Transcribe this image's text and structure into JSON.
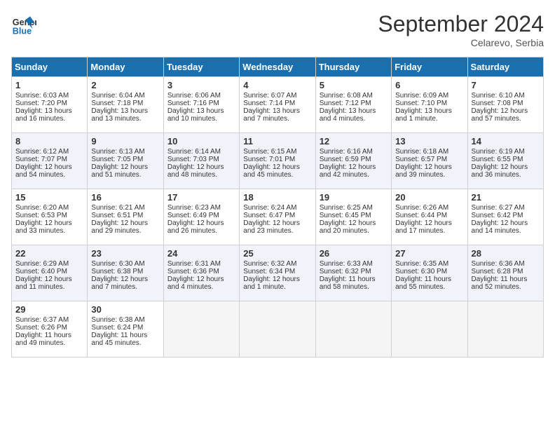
{
  "header": {
    "logo_line1": "General",
    "logo_line2": "Blue",
    "month": "September 2024",
    "location": "Celarevo, Serbia"
  },
  "days_of_week": [
    "Sunday",
    "Monday",
    "Tuesday",
    "Wednesday",
    "Thursday",
    "Friday",
    "Saturday"
  ],
  "weeks": [
    [
      {
        "day": 1,
        "sunrise": "6:03 AM",
        "sunset": "7:20 PM",
        "daylight": "13 hours and 16 minutes."
      },
      {
        "day": 2,
        "sunrise": "6:04 AM",
        "sunset": "7:18 PM",
        "daylight": "13 hours and 13 minutes."
      },
      {
        "day": 3,
        "sunrise": "6:06 AM",
        "sunset": "7:16 PM",
        "daylight": "13 hours and 10 minutes."
      },
      {
        "day": 4,
        "sunrise": "6:07 AM",
        "sunset": "7:14 PM",
        "daylight": "13 hours and 7 minutes."
      },
      {
        "day": 5,
        "sunrise": "6:08 AM",
        "sunset": "7:12 PM",
        "daylight": "13 hours and 4 minutes."
      },
      {
        "day": 6,
        "sunrise": "6:09 AM",
        "sunset": "7:10 PM",
        "daylight": "13 hours and 1 minute."
      },
      {
        "day": 7,
        "sunrise": "6:10 AM",
        "sunset": "7:08 PM",
        "daylight": "12 hours and 57 minutes."
      }
    ],
    [
      {
        "day": 8,
        "sunrise": "6:12 AM",
        "sunset": "7:07 PM",
        "daylight": "12 hours and 54 minutes."
      },
      {
        "day": 9,
        "sunrise": "6:13 AM",
        "sunset": "7:05 PM",
        "daylight": "12 hours and 51 minutes."
      },
      {
        "day": 10,
        "sunrise": "6:14 AM",
        "sunset": "7:03 PM",
        "daylight": "12 hours and 48 minutes."
      },
      {
        "day": 11,
        "sunrise": "6:15 AM",
        "sunset": "7:01 PM",
        "daylight": "12 hours and 45 minutes."
      },
      {
        "day": 12,
        "sunrise": "6:16 AM",
        "sunset": "6:59 PM",
        "daylight": "12 hours and 42 minutes."
      },
      {
        "day": 13,
        "sunrise": "6:18 AM",
        "sunset": "6:57 PM",
        "daylight": "12 hours and 39 minutes."
      },
      {
        "day": 14,
        "sunrise": "6:19 AM",
        "sunset": "6:55 PM",
        "daylight": "12 hours and 36 minutes."
      }
    ],
    [
      {
        "day": 15,
        "sunrise": "6:20 AM",
        "sunset": "6:53 PM",
        "daylight": "12 hours and 33 minutes."
      },
      {
        "day": 16,
        "sunrise": "6:21 AM",
        "sunset": "6:51 PM",
        "daylight": "12 hours and 29 minutes."
      },
      {
        "day": 17,
        "sunrise": "6:23 AM",
        "sunset": "6:49 PM",
        "daylight": "12 hours and 26 minutes."
      },
      {
        "day": 18,
        "sunrise": "6:24 AM",
        "sunset": "6:47 PM",
        "daylight": "12 hours and 23 minutes."
      },
      {
        "day": 19,
        "sunrise": "6:25 AM",
        "sunset": "6:45 PM",
        "daylight": "12 hours and 20 minutes."
      },
      {
        "day": 20,
        "sunrise": "6:26 AM",
        "sunset": "6:44 PM",
        "daylight": "12 hours and 17 minutes."
      },
      {
        "day": 21,
        "sunrise": "6:27 AM",
        "sunset": "6:42 PM",
        "daylight": "12 hours and 14 minutes."
      }
    ],
    [
      {
        "day": 22,
        "sunrise": "6:29 AM",
        "sunset": "6:40 PM",
        "daylight": "12 hours and 11 minutes."
      },
      {
        "day": 23,
        "sunrise": "6:30 AM",
        "sunset": "6:38 PM",
        "daylight": "12 hours and 7 minutes."
      },
      {
        "day": 24,
        "sunrise": "6:31 AM",
        "sunset": "6:36 PM",
        "daylight": "12 hours and 4 minutes."
      },
      {
        "day": 25,
        "sunrise": "6:32 AM",
        "sunset": "6:34 PM",
        "daylight": "12 hours and 1 minute."
      },
      {
        "day": 26,
        "sunrise": "6:33 AM",
        "sunset": "6:32 PM",
        "daylight": "11 hours and 58 minutes."
      },
      {
        "day": 27,
        "sunrise": "6:35 AM",
        "sunset": "6:30 PM",
        "daylight": "11 hours and 55 minutes."
      },
      {
        "day": 28,
        "sunrise": "6:36 AM",
        "sunset": "6:28 PM",
        "daylight": "11 hours and 52 minutes."
      }
    ],
    [
      {
        "day": 29,
        "sunrise": "6:37 AM",
        "sunset": "6:26 PM",
        "daylight": "11 hours and 49 minutes."
      },
      {
        "day": 30,
        "sunrise": "6:38 AM",
        "sunset": "6:24 PM",
        "daylight": "11 hours and 45 minutes."
      },
      null,
      null,
      null,
      null,
      null
    ]
  ]
}
